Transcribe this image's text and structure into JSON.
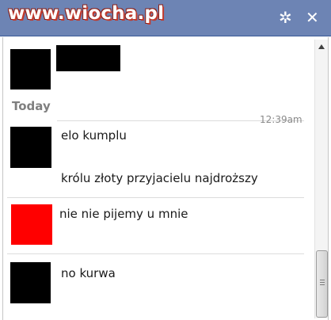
{
  "titlebar": {
    "watermark": "www.wiocha.pl",
    "settings_icon": "gear-icon",
    "close_icon": "close-icon",
    "close_glyph": "✕",
    "settings_glyph": "✲",
    "bg_color": "#6d84b4"
  },
  "chat": {
    "day_label": "Today",
    "timestamp": "12:39am",
    "messages": [
      {
        "avatar_color": "#000000",
        "lines": [
          "elo kumplu",
          "królu złoty przyjacielu najdroższy"
        ]
      },
      {
        "avatar_color": "#ff0000",
        "lines": [
          "nie nie pijemy u mnie"
        ]
      },
      {
        "avatar_color": "#000000",
        "lines": [
          "no kurwa"
        ]
      }
    ]
  },
  "scrollbar": {
    "up_icon": "scroll-up-arrow-icon",
    "thumb_icon": "scroll-thumb-grip-icon"
  }
}
